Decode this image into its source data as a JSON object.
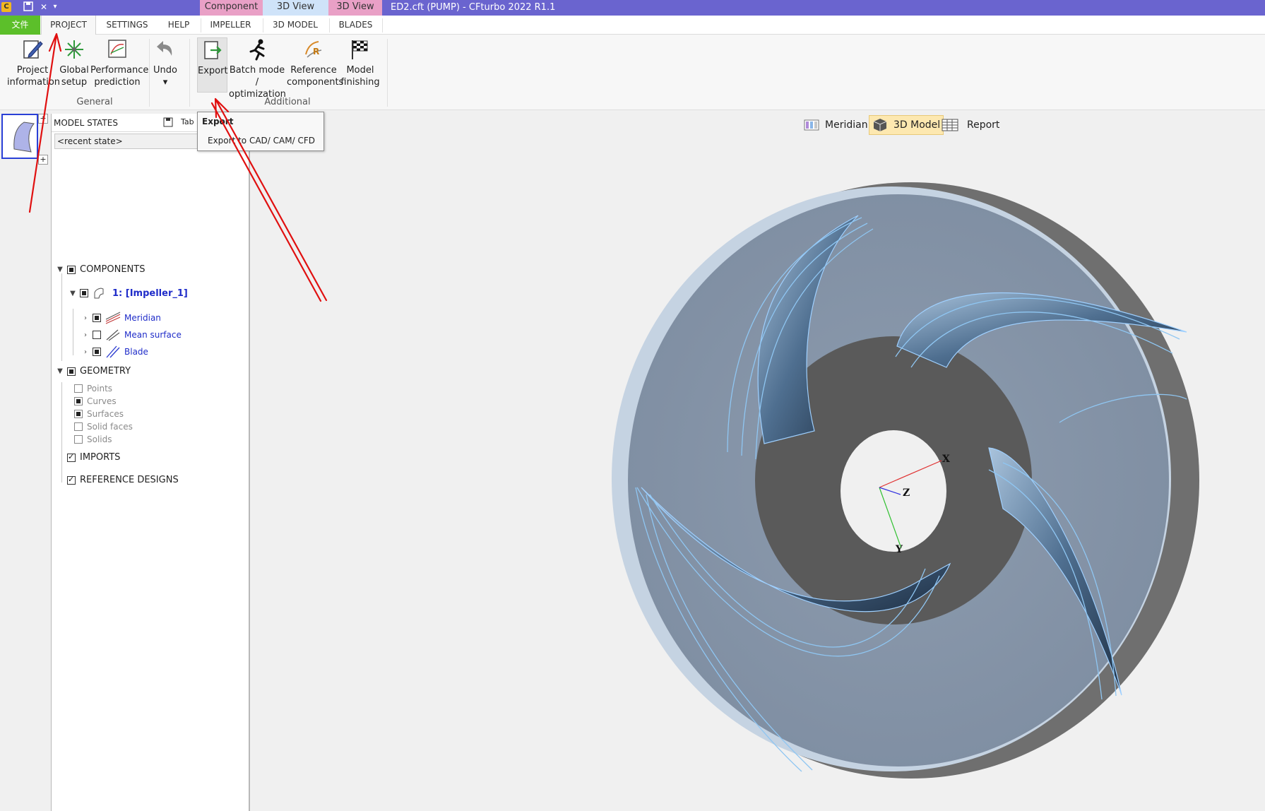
{
  "titlebar": {
    "logo": "C",
    "contextual_tabs": [
      "Component",
      "3D View",
      "3D View"
    ],
    "document_title": "ED2.cft (PUMP) - CFturbo 2022 R1.1",
    "colors": {
      "bar": "#6a64cf",
      "component_tab": "#e9a0c6",
      "view_tab_1": "#cfe3f9",
      "view_tab_2": "#e9a0c6"
    }
  },
  "tabs": {
    "file": "文件",
    "items": [
      "PROJECT",
      "SETTINGS",
      "HELP",
      "IMPELLER",
      "3D MODEL",
      "BLADES"
    ],
    "active": "PROJECT"
  },
  "ribbon": {
    "groups": [
      {
        "label": "General",
        "buttons": [
          {
            "line1": "Project",
            "line2": "information",
            "icon": "project-info-icon"
          },
          {
            "line1": "Global",
            "line2": "setup",
            "icon": "global-setup-icon"
          },
          {
            "line1": "Performance",
            "line2": "prediction",
            "icon": "performance-icon"
          },
          {
            "line1": "Undo",
            "line2": "▾",
            "icon": "undo-icon"
          }
        ]
      },
      {
        "label": "Additional",
        "buttons": [
          {
            "line1": "Export",
            "line2": "",
            "icon": "export-icon"
          },
          {
            "line1": "Batch mode /",
            "line2": "optimization",
            "icon": "runner-icon"
          },
          {
            "line1": "Reference",
            "line2": "components",
            "icon": "reference-icon"
          },
          {
            "line1": "Model",
            "line2": "finishing",
            "icon": "checkered-flag-icon"
          }
        ]
      }
    ]
  },
  "tooltip": {
    "title": "Export",
    "text": "Export to CAD/ CAM/ CFD"
  },
  "model_states": {
    "label": "MODEL STATES",
    "tab_label": "Tab",
    "select_value": "<recent state>"
  },
  "tree": {
    "components": "COMPONENTS",
    "impeller": "1: [Impeller_1]",
    "meridian": "Meridian",
    "mean_surface": "Mean surface",
    "blade": "Blade",
    "geometry": "GEOMETRY",
    "points": "Points",
    "curves": "Curves",
    "surfaces": "Surfaces",
    "solid_faces": "Solid faces",
    "solids": "Solids",
    "imports": "IMPORTS",
    "reference_designs": "REFERENCE DESIGNS"
  },
  "view_switch": {
    "meridian": "Meridian",
    "model3d": "3D Model",
    "report": "Report",
    "active": "3D Model"
  },
  "axes": {
    "x": "X",
    "y": "Y",
    "z": "Z"
  }
}
